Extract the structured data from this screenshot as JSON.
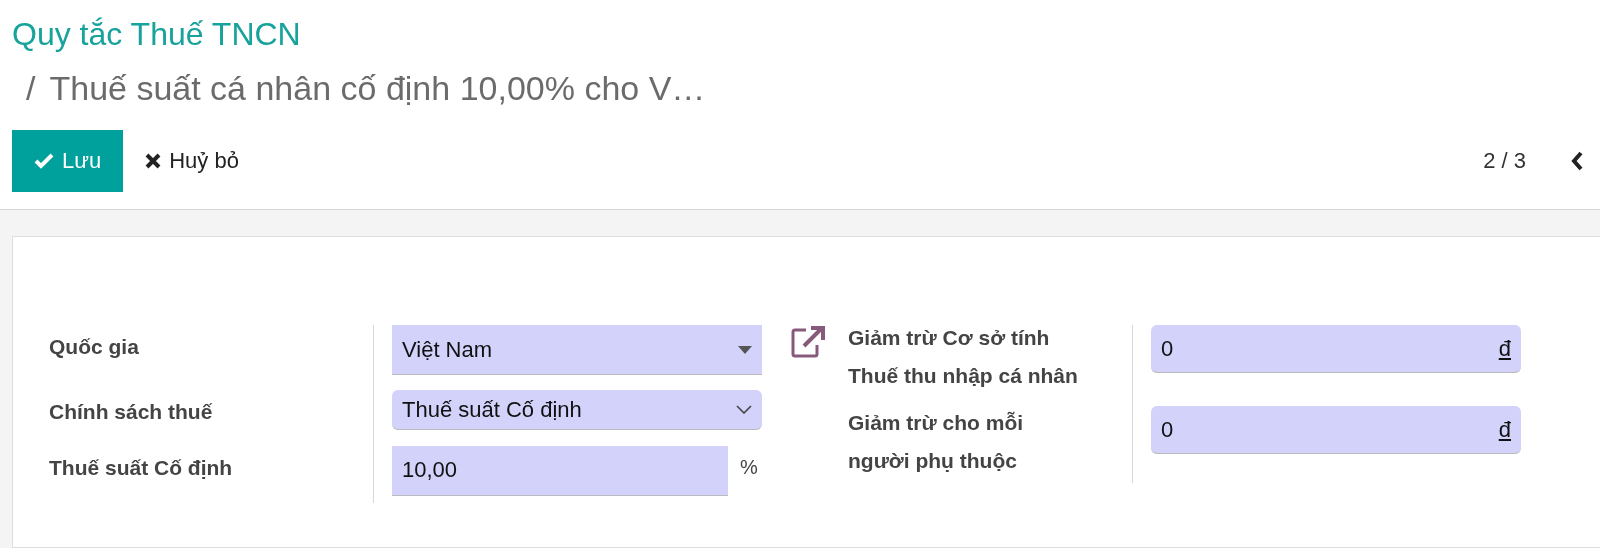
{
  "breadcrumb": {
    "parent": "Quy tắc Thuế TNCN",
    "current": "Thuế suất cá nhân cố định 10,00% cho V…",
    "separator": "/"
  },
  "buttons": [
    {
      "kind": "save",
      "label": "Lưu"
    },
    {
      "kind": "discard",
      "label": "Huỷ bỏ"
    }
  ],
  "pager": {
    "value": "2 / 3"
  },
  "left_fields": [
    {
      "kind": "many2one",
      "label": "Quốc gia",
      "value": "Việt Nam"
    },
    {
      "kind": "selection",
      "label": "Chính sách thuế",
      "value": "Thuế suất Cố định"
    },
    {
      "kind": "float",
      "label": "Thuế suất Cố định",
      "value": "10,00",
      "suffix": "%"
    }
  ],
  "right_fields": [
    {
      "kind": "monetary",
      "label": "Giảm trừ Cơ sở tính Thuế thu nhập cá nhân",
      "value": "0",
      "currency": "đ",
      "link_icon": true
    },
    {
      "kind": "monetary",
      "label": "Giảm trừ cho mỗi người phụ thuộc",
      "value": "0",
      "currency": "đ",
      "link_icon": false
    }
  ]
}
